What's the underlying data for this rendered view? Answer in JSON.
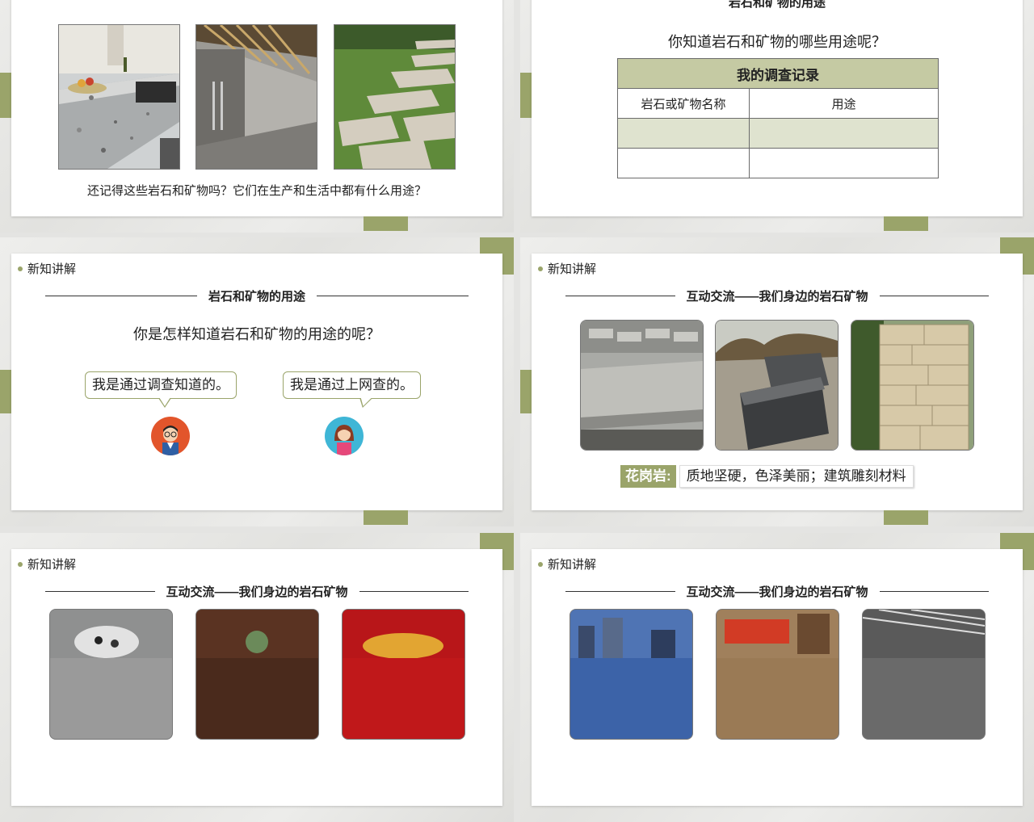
{
  "slides": {
    "s1": {
      "caption": "还记得这些岩石和矿物吗？它们在生产和生活中都有什么用途？"
    },
    "s2": {
      "header_partial": "岩石和矿物的用途",
      "question": "你知道岩石和矿物的哪些用途呢？",
      "table": {
        "title": "我的调查记录",
        "col1": "岩石或矿物名称",
        "col2": "用途"
      }
    },
    "s3": {
      "section": "新知讲解",
      "title": "岩石和矿物的用途",
      "question": "你是怎样知道岩石和矿物的用途的呢？",
      "bubble_left": "我是通过调查知道的。",
      "bubble_right": "我是通过上网查的。"
    },
    "s4": {
      "section": "新知讲解",
      "title": "互动交流——我们身边的岩石矿物",
      "tag": "花岗岩:",
      "desc": "质地坚硬，色泽美丽；建筑雕刻材料"
    },
    "s5": {
      "section": "新知讲解",
      "title": "互动交流——我们身边的岩石矿物"
    },
    "s6": {
      "section": "新知讲解",
      "title": "互动交流——我们身边的岩石矿物"
    }
  },
  "colors": {
    "accent": "#9aa46a",
    "table_header": "#c5caa3",
    "table_shade": "#dfe3cf"
  }
}
